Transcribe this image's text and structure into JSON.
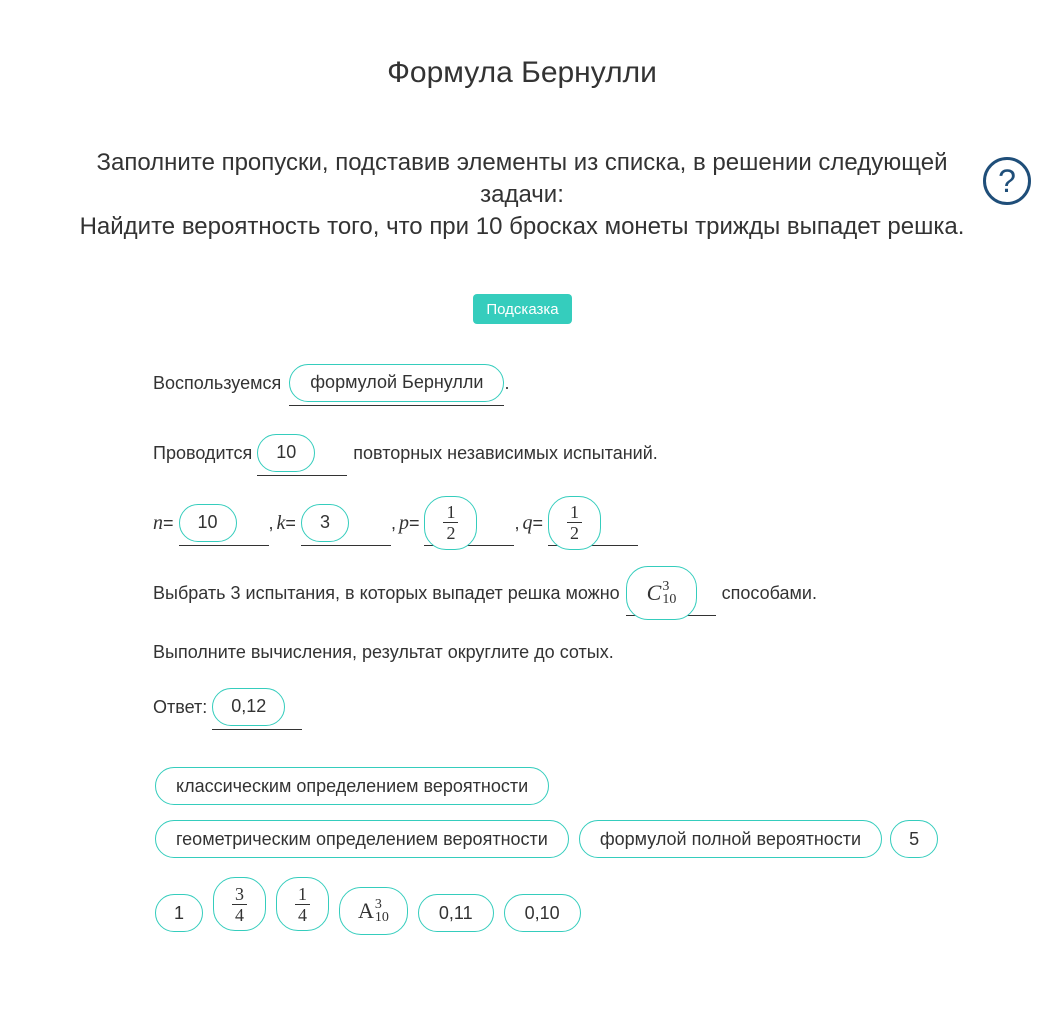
{
  "title": "Формула Бернулли",
  "task": {
    "instruction": "Заполните пропуски, подставив элементы из списка, в решении следующей задачи:",
    "problem": "Найдите вероятность того, что при 10 бросках монеты трижды выпадет решка."
  },
  "hint_button": "Подсказка",
  "help_icon": "question-circle-icon",
  "accent_color": "#35cdbd",
  "help_color": "#1f4e79",
  "solution": {
    "line1": {
      "before": "Воспользуемся",
      "answer": "формулой Бернулли",
      "after": "."
    },
    "line2": {
      "before": "Проводится",
      "answer": "10",
      "after": "повторных независимых испытаний."
    },
    "line3": {
      "n_label": "n",
      "n_value": "10",
      "k_label": "k",
      "k_value": "3",
      "p_label": "p",
      "p_num": "1",
      "p_den": "2",
      "q_label": "q",
      "q_num": "1",
      "q_den": "2",
      "eq": "=",
      "sep": ","
    },
    "line4": {
      "before": "Выбрать 3 испытания, в которых выпадет решка можно",
      "comb_letter": "C",
      "comb_sup": "3",
      "comb_sub": "10",
      "after": "способами."
    },
    "line5": {
      "text": "Выполните вычисления, результат округлите до сотых."
    },
    "line6": {
      "before": "Ответ:",
      "answer": "0,12"
    }
  },
  "options": {
    "opt1": "классическим определением вероятности",
    "opt2": "геометрическим определением вероятности",
    "opt3": "формулой полной вероятности",
    "opt4": "5",
    "opt5": "1",
    "opt6_num": "3",
    "opt6_den": "4",
    "opt7_num": "1",
    "opt7_den": "4",
    "opt8_letter": "A",
    "opt8_sup": "3",
    "opt8_sub": "10",
    "opt9": "0,11",
    "opt10": "0,10"
  }
}
